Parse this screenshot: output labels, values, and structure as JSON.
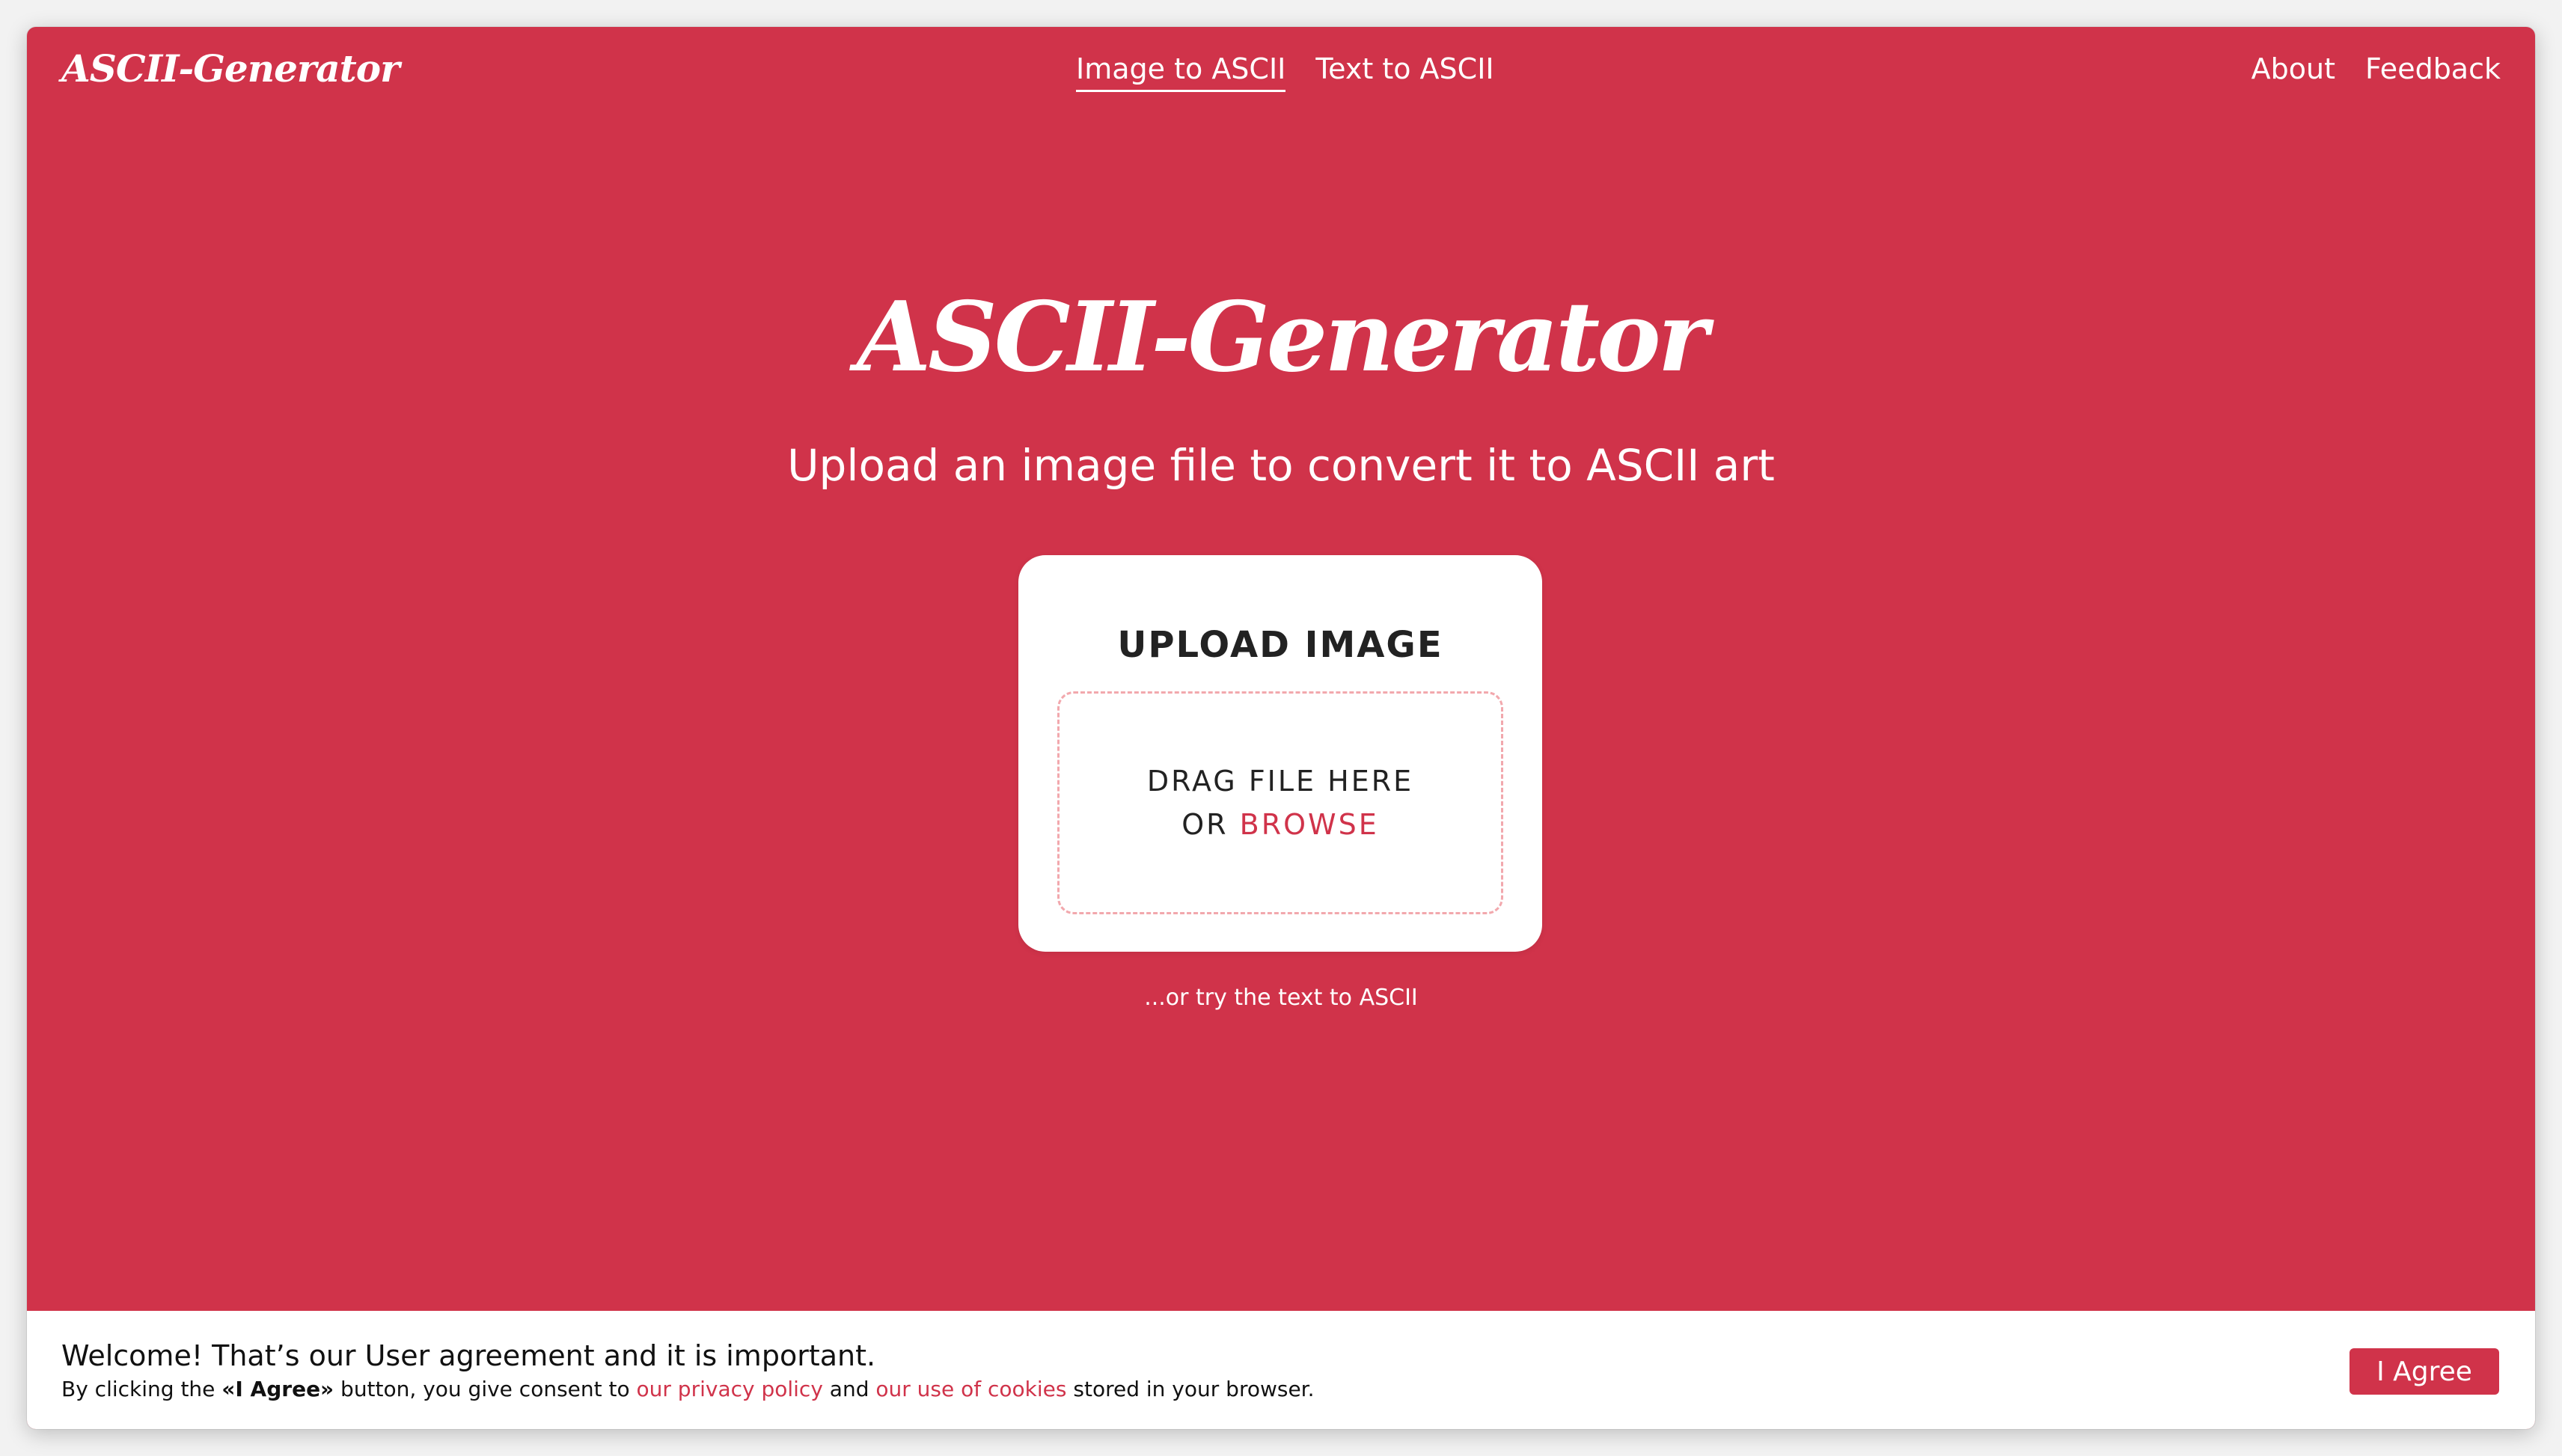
{
  "colors": {
    "brand": "#d0334a",
    "surface": "#ffffff",
    "text_dark": "#222222",
    "dashed_border": "#f2a8ad"
  },
  "header": {
    "logo": "ASCII-Generator",
    "nav_center": [
      {
        "label": "Image to ASCII",
        "active": true
      },
      {
        "label": "Text to ASCII",
        "active": false
      }
    ],
    "nav_right": [
      {
        "label": "About"
      },
      {
        "label": "Feedback"
      }
    ]
  },
  "hero": {
    "title": "ASCII-Generator",
    "subtitle": "Upload an image file to convert it to ASCII art"
  },
  "upload": {
    "heading": "UPLOAD IMAGE",
    "drag_text": "DRAG FILE HERE",
    "or_text": "OR ",
    "browse_label": "BROWSE"
  },
  "alt_link": "...or try the text to ASCII",
  "consent": {
    "title": "Welcome! That’s our User agreement and it is important.",
    "body_prefix": "By clicking the ",
    "button_quote": "«I Agree»",
    "body_middle": " button, you give consent to ",
    "privacy_link": "our privacy policy",
    "and_text": " and ",
    "cookies_link": "our use of cookies",
    "body_suffix": " stored in your browser.",
    "agree_button": "I Agree"
  }
}
